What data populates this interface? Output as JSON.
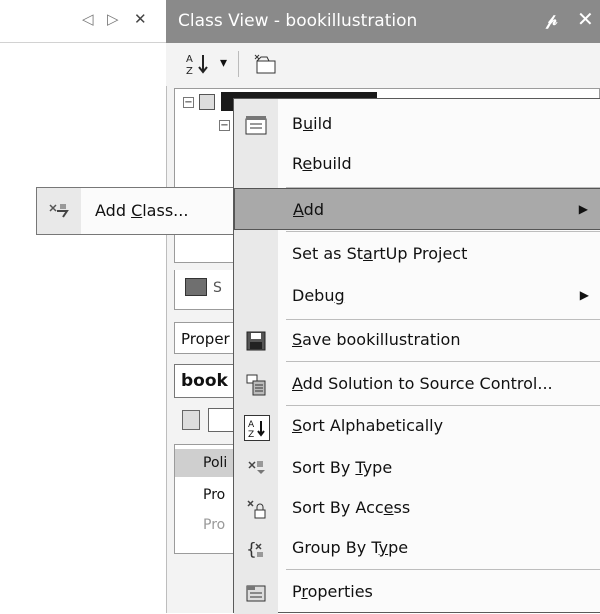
{
  "left_pane": {
    "buttons": {
      "back": "◁",
      "forward": "▷",
      "close": "✕"
    }
  },
  "class_view": {
    "title": "Class View - bookillustration",
    "pin_icon": "pin-icon",
    "close_icon": "close-icon",
    "toolbar": {
      "sort_glyph": "A↓Z",
      "dropdown": "▾",
      "new_folder_icon": "new-folder-icon"
    },
    "tree": {
      "root_toggle": "⊟",
      "child_toggle": "⊟"
    },
    "solution_tab_label": "S"
  },
  "properties": {
    "header": "Proper",
    "object": "book",
    "rows": [
      {
        "label": "Poli"
      },
      {
        "label": "Pro"
      },
      {
        "label": "Pro"
      }
    ]
  },
  "context_menu": {
    "items": [
      {
        "label": "Build",
        "icon": "build-icon"
      },
      {
        "label": "Rebuild"
      },
      {
        "label": "Add",
        "has_submenu": true,
        "highlighted": true
      },
      {
        "label": "Set as StartUp Project"
      },
      {
        "label": "Debug",
        "has_submenu": true
      },
      {
        "label": "Save bookillustration",
        "icon": "save-icon"
      },
      {
        "label": "Add Solution to Source Control...",
        "icon": "source-control-icon"
      },
      {
        "label": "Sort Alphabetically",
        "icon": "sort-alpha-icon"
      },
      {
        "label": "Sort By Type",
        "icon": "sort-type-icon"
      },
      {
        "label": "Sort By Access",
        "icon": "sort-access-icon"
      },
      {
        "label": "Group By Type",
        "icon": "group-type-icon"
      },
      {
        "label": "Properties",
        "icon": "properties-icon"
      }
    ]
  },
  "submenu": {
    "items": [
      {
        "label": "Add Class...",
        "icon": "add-class-icon"
      }
    ]
  }
}
